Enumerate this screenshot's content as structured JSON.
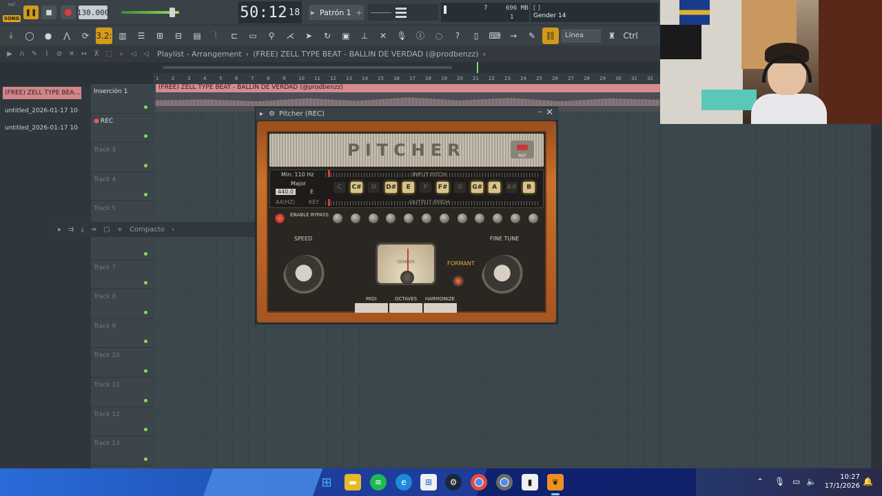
{
  "transport": {
    "pat_label": "PAT",
    "song_label": "SONG",
    "tempo": "130.000",
    "time_main": "50:12",
    "time_small": "18",
    "pattern": "Patrón 1",
    "cpu_num1": "7",
    "mem": "696 MB",
    "cpu_num2": "1",
    "hint_bracket": "[ ]",
    "hint_title": "Gender 14"
  },
  "toolbar": {
    "mode_label": "3.2:",
    "line_select": "Línea",
    "ctrl_label": "Ctrl"
  },
  "playlist": {
    "title": "Playlist - Arrangement",
    "project": "(FREE) ZELL TYPE BEAT -  BALLIN DE VERDAD  (@prodbenzz)"
  },
  "picker": {
    "items": [
      "(FREE) ZELL TYPE BEA...",
      "untitled_2026-01-17 10-...",
      "untitled_2026-01-17 10-..."
    ]
  },
  "tracks": [
    "Inserción 1",
    "REC",
    "Track 3",
    "Track 4",
    "Track 5",
    "",
    "Track 7",
    "Track 8",
    "Track 9",
    "Track 10",
    "Track 11",
    "Track 12",
    "Track 13"
  ],
  "timeline": [
    "1",
    "2",
    "3",
    "4",
    "5",
    "6",
    "7",
    "8",
    "9",
    "10",
    "11",
    "12",
    "13",
    "14",
    "15",
    "16",
    "17",
    "18",
    "19",
    "20",
    "21",
    "22",
    "23",
    "24",
    "25",
    "26",
    "27",
    "28",
    "29",
    "30",
    "31",
    "32"
  ],
  "clip": {
    "label": "(FREE) ZELL TYPE BEAT -  BALLIN DE VERDAD  (@prodbenzz)"
  },
  "compact": {
    "label": "Compacto"
  },
  "pitcher": {
    "window_title": "Pitcher (REC)",
    "logo": "PITCHER",
    "ref": "REF",
    "min_hz": "Min: 110 Hz",
    "scale": "Major",
    "a4_value": "440.0",
    "key_value": "E",
    "a4_label": "A4(HZ)",
    "key_label": "KEY",
    "input_label": "INPUT PITCH",
    "output_label": "OUTPUT PITCH",
    "notes": [
      {
        "n": "C",
        "on": false
      },
      {
        "n": "C#",
        "on": true
      },
      {
        "n": "D",
        "on": false
      },
      {
        "n": "D#",
        "on": true
      },
      {
        "n": "E",
        "on": true
      },
      {
        "n": "F",
        "on": false
      },
      {
        "n": "F#",
        "on": true
      },
      {
        "n": "G",
        "on": false
      },
      {
        "n": "G#",
        "on": true
      },
      {
        "n": "A",
        "on": true
      },
      {
        "n": "A#",
        "on": false
      },
      {
        "n": "B",
        "on": true
      }
    ],
    "bypass_label": "ENABLE BYPASS",
    "speed_label": "SPEED",
    "fine_tune_label": "FINE TUNE",
    "gender_label": "GENDER",
    "formant_label": "FORMANT",
    "midi_label": "MIDI",
    "octaves_label": "OCTAVES",
    "harmonize_label": "HARMONIZE"
  },
  "taskbar": {
    "time": "10:27",
    "date": "17/1/2026"
  }
}
